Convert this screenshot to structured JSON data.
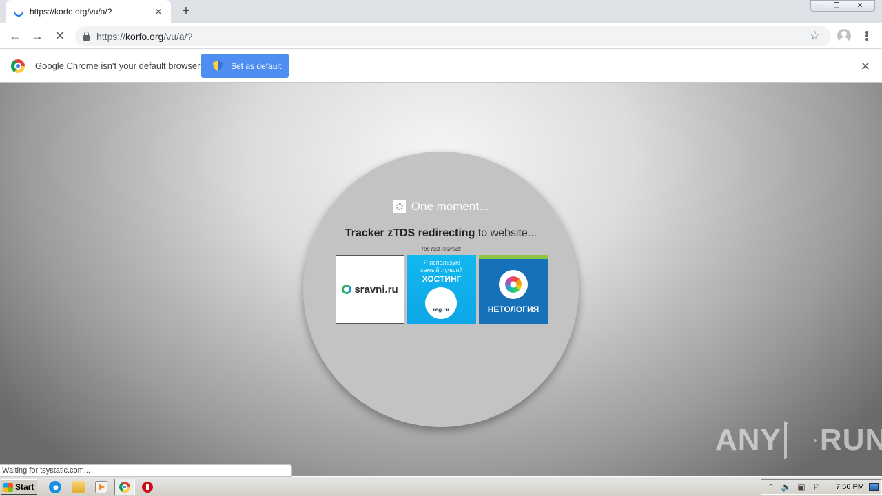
{
  "browser": {
    "tab": {
      "title": "https://korfo.org/vu/a/?",
      "close": "✕"
    },
    "new_tab": "+",
    "window_controls": {
      "minimize": "—",
      "restore": "❐",
      "close": "✕"
    },
    "nav": {
      "back": "←",
      "forward": "→",
      "stop": "✕"
    },
    "address": {
      "scheme": "https://",
      "host": "korfo.org",
      "path": "/vu/a/?"
    },
    "bookmark_star": "☆"
  },
  "infobar": {
    "message": "Google Chrome isn't your default browser",
    "button_label": "Set as default",
    "close": "✕"
  },
  "page": {
    "moment": "One moment...",
    "redirect_bold": "Tracker zTDS redirecting",
    "redirect_rest": " to website...",
    "top_last": "Top last redirect:",
    "thumbs": {
      "sravni": "sravni.ru",
      "hosting_line1": "Я использую",
      "hosting_line2": "самый лучший",
      "hosting_line3": "ХОСТИНГ",
      "hosting_badge": "reg.ru",
      "netology": "НЕТОЛОГИЯ"
    },
    "watermark_left": "ANY",
    "watermark_right": "RUN"
  },
  "status_bar": "Waiting for tsystatic.com...",
  "taskbar": {
    "start": "Start",
    "clock": "7:56 PM"
  },
  "colors": {
    "accent_button": "#4d8ef0",
    "tab_spinner": "#1a73e8",
    "circle": "#c3c3c3"
  }
}
